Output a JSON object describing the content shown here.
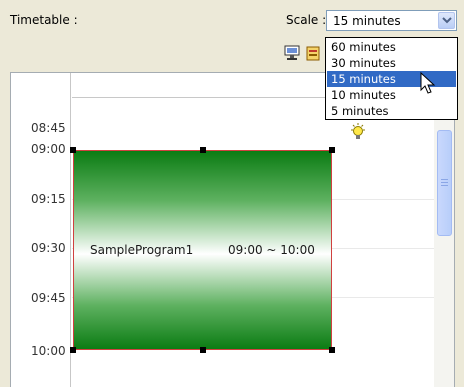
{
  "header": {
    "timetable_label": "Timetable :",
    "scale_label": "Scale :"
  },
  "scale": {
    "selected": "15 minutes",
    "options": [
      "60 minutes",
      "30 minutes",
      "15 minutes",
      "10 minutes",
      "5 minutes"
    ],
    "highlighted_index": 2
  },
  "times": [
    "08:45",
    "09:00",
    "09:15",
    "09:30",
    "09:45",
    "10:00"
  ],
  "program": {
    "name": "SampleProgram1",
    "time_range": "09:00 ~ 10:00",
    "color": "#0b7c13"
  },
  "icons": [
    "view-icon",
    "schedule-icon",
    "lightbulb-icon",
    "chevron-down-icon",
    "mouse-cursor-icon"
  ],
  "colors": {
    "window_bg": "#ece9d8",
    "selection": "#316ac5",
    "program_green": "#0b7c13",
    "program_border": "#d04040"
  }
}
